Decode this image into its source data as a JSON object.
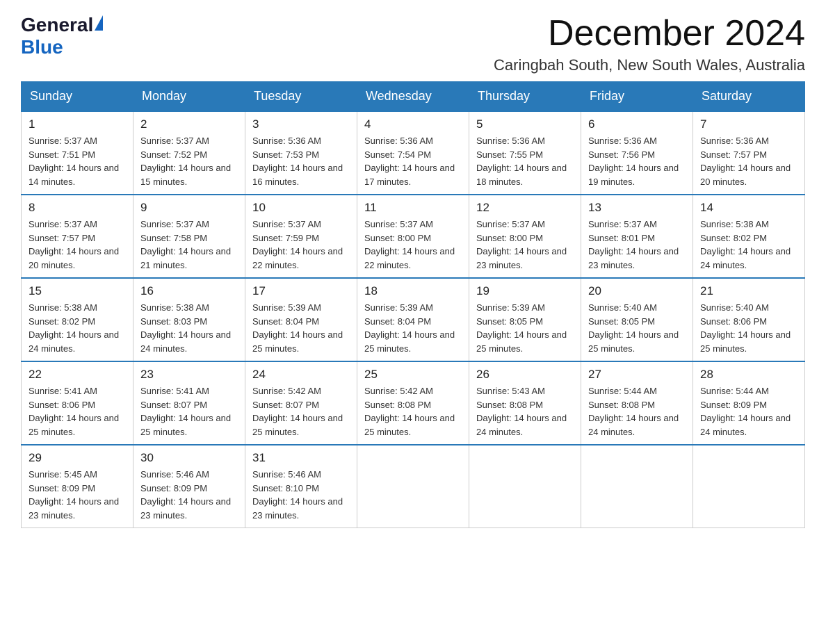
{
  "logo": {
    "general": "General",
    "blue": "Blue"
  },
  "header": {
    "month_year": "December 2024",
    "location": "Caringbah South, New South Wales, Australia"
  },
  "days_of_week": [
    "Sunday",
    "Monday",
    "Tuesday",
    "Wednesday",
    "Thursday",
    "Friday",
    "Saturday"
  ],
  "weeks": [
    [
      {
        "day": "1",
        "sunrise": "Sunrise: 5:37 AM",
        "sunset": "Sunset: 7:51 PM",
        "daylight": "Daylight: 14 hours and 14 minutes."
      },
      {
        "day": "2",
        "sunrise": "Sunrise: 5:37 AM",
        "sunset": "Sunset: 7:52 PM",
        "daylight": "Daylight: 14 hours and 15 minutes."
      },
      {
        "day": "3",
        "sunrise": "Sunrise: 5:36 AM",
        "sunset": "Sunset: 7:53 PM",
        "daylight": "Daylight: 14 hours and 16 minutes."
      },
      {
        "day": "4",
        "sunrise": "Sunrise: 5:36 AM",
        "sunset": "Sunset: 7:54 PM",
        "daylight": "Daylight: 14 hours and 17 minutes."
      },
      {
        "day": "5",
        "sunrise": "Sunrise: 5:36 AM",
        "sunset": "Sunset: 7:55 PM",
        "daylight": "Daylight: 14 hours and 18 minutes."
      },
      {
        "day": "6",
        "sunrise": "Sunrise: 5:36 AM",
        "sunset": "Sunset: 7:56 PM",
        "daylight": "Daylight: 14 hours and 19 minutes."
      },
      {
        "day": "7",
        "sunrise": "Sunrise: 5:36 AM",
        "sunset": "Sunset: 7:57 PM",
        "daylight": "Daylight: 14 hours and 20 minutes."
      }
    ],
    [
      {
        "day": "8",
        "sunrise": "Sunrise: 5:37 AM",
        "sunset": "Sunset: 7:57 PM",
        "daylight": "Daylight: 14 hours and 20 minutes."
      },
      {
        "day": "9",
        "sunrise": "Sunrise: 5:37 AM",
        "sunset": "Sunset: 7:58 PM",
        "daylight": "Daylight: 14 hours and 21 minutes."
      },
      {
        "day": "10",
        "sunrise": "Sunrise: 5:37 AM",
        "sunset": "Sunset: 7:59 PM",
        "daylight": "Daylight: 14 hours and 22 minutes."
      },
      {
        "day": "11",
        "sunrise": "Sunrise: 5:37 AM",
        "sunset": "Sunset: 8:00 PM",
        "daylight": "Daylight: 14 hours and 22 minutes."
      },
      {
        "day": "12",
        "sunrise": "Sunrise: 5:37 AM",
        "sunset": "Sunset: 8:00 PM",
        "daylight": "Daylight: 14 hours and 23 minutes."
      },
      {
        "day": "13",
        "sunrise": "Sunrise: 5:37 AM",
        "sunset": "Sunset: 8:01 PM",
        "daylight": "Daylight: 14 hours and 23 minutes."
      },
      {
        "day": "14",
        "sunrise": "Sunrise: 5:38 AM",
        "sunset": "Sunset: 8:02 PM",
        "daylight": "Daylight: 14 hours and 24 minutes."
      }
    ],
    [
      {
        "day": "15",
        "sunrise": "Sunrise: 5:38 AM",
        "sunset": "Sunset: 8:02 PM",
        "daylight": "Daylight: 14 hours and 24 minutes."
      },
      {
        "day": "16",
        "sunrise": "Sunrise: 5:38 AM",
        "sunset": "Sunset: 8:03 PM",
        "daylight": "Daylight: 14 hours and 24 minutes."
      },
      {
        "day": "17",
        "sunrise": "Sunrise: 5:39 AM",
        "sunset": "Sunset: 8:04 PM",
        "daylight": "Daylight: 14 hours and 25 minutes."
      },
      {
        "day": "18",
        "sunrise": "Sunrise: 5:39 AM",
        "sunset": "Sunset: 8:04 PM",
        "daylight": "Daylight: 14 hours and 25 minutes."
      },
      {
        "day": "19",
        "sunrise": "Sunrise: 5:39 AM",
        "sunset": "Sunset: 8:05 PM",
        "daylight": "Daylight: 14 hours and 25 minutes."
      },
      {
        "day": "20",
        "sunrise": "Sunrise: 5:40 AM",
        "sunset": "Sunset: 8:05 PM",
        "daylight": "Daylight: 14 hours and 25 minutes."
      },
      {
        "day": "21",
        "sunrise": "Sunrise: 5:40 AM",
        "sunset": "Sunset: 8:06 PM",
        "daylight": "Daylight: 14 hours and 25 minutes."
      }
    ],
    [
      {
        "day": "22",
        "sunrise": "Sunrise: 5:41 AM",
        "sunset": "Sunset: 8:06 PM",
        "daylight": "Daylight: 14 hours and 25 minutes."
      },
      {
        "day": "23",
        "sunrise": "Sunrise: 5:41 AM",
        "sunset": "Sunset: 8:07 PM",
        "daylight": "Daylight: 14 hours and 25 minutes."
      },
      {
        "day": "24",
        "sunrise": "Sunrise: 5:42 AM",
        "sunset": "Sunset: 8:07 PM",
        "daylight": "Daylight: 14 hours and 25 minutes."
      },
      {
        "day": "25",
        "sunrise": "Sunrise: 5:42 AM",
        "sunset": "Sunset: 8:08 PM",
        "daylight": "Daylight: 14 hours and 25 minutes."
      },
      {
        "day": "26",
        "sunrise": "Sunrise: 5:43 AM",
        "sunset": "Sunset: 8:08 PM",
        "daylight": "Daylight: 14 hours and 24 minutes."
      },
      {
        "day": "27",
        "sunrise": "Sunrise: 5:44 AM",
        "sunset": "Sunset: 8:08 PM",
        "daylight": "Daylight: 14 hours and 24 minutes."
      },
      {
        "day": "28",
        "sunrise": "Sunrise: 5:44 AM",
        "sunset": "Sunset: 8:09 PM",
        "daylight": "Daylight: 14 hours and 24 minutes."
      }
    ],
    [
      {
        "day": "29",
        "sunrise": "Sunrise: 5:45 AM",
        "sunset": "Sunset: 8:09 PM",
        "daylight": "Daylight: 14 hours and 23 minutes."
      },
      {
        "day": "30",
        "sunrise": "Sunrise: 5:46 AM",
        "sunset": "Sunset: 8:09 PM",
        "daylight": "Daylight: 14 hours and 23 minutes."
      },
      {
        "day": "31",
        "sunrise": "Sunrise: 5:46 AM",
        "sunset": "Sunset: 8:10 PM",
        "daylight": "Daylight: 14 hours and 23 minutes."
      },
      null,
      null,
      null,
      null
    ]
  ]
}
